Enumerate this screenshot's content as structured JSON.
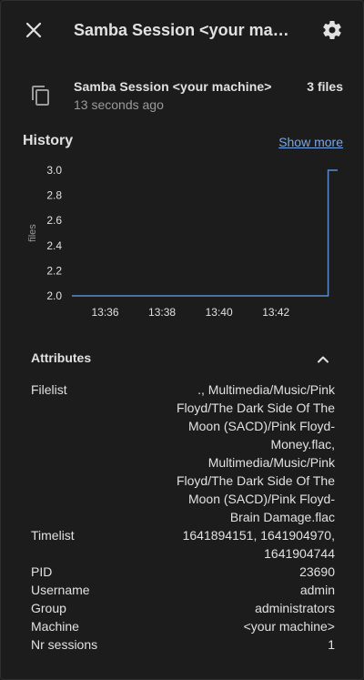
{
  "header": {
    "title": "Samba Session <your machine>",
    "close_icon": "close-icon",
    "settings_icon": "gear-icon"
  },
  "entity": {
    "name": "Samba Session <your machine>",
    "last_changed": "13 seconds ago",
    "state": "3 files",
    "icon": "file-document-icon"
  },
  "history": {
    "title": "History",
    "show_more": "Show more"
  },
  "chart_data": {
    "type": "line",
    "ylabel": "files",
    "y_ticks": [
      "3.0",
      "2.8",
      "2.6",
      "2.4",
      "2.2",
      "2.0"
    ],
    "x_ticks": [
      "13:36",
      "13:38",
      "13:40",
      "13:42"
    ],
    "ylim": [
      2.0,
      3.0
    ],
    "series": [
      {
        "x": [
          "13:34:50",
          "13:43:50",
          "13:43:50",
          "13:44:10"
        ],
        "values": [
          2.0,
          2.0,
          3.0,
          3.0
        ],
        "color": "#5b8bd0"
      }
    ],
    "grid": false
  },
  "attributes": {
    "title": "Attributes",
    "chevron_icon": "chevron-up-icon",
    "rows": [
      {
        "key": "Filelist",
        "value": "., Multimedia/Music/Pink Floyd/The Dark Side Of The Moon (SACD)/Pink Floyd-Money.flac, Multimedia/Music/Pink Floyd/The Dark Side Of The Moon (SACD)/Pink Floyd-Brain Damage.flac"
      },
      {
        "key": "Timelist",
        "value": "1641894151, 1641904970, 1641904744"
      },
      {
        "key": "PID",
        "value": "23690"
      },
      {
        "key": "Username",
        "value": "admin"
      },
      {
        "key": "Group",
        "value": "administrators"
      },
      {
        "key": "Machine",
        "value": "<your machine>"
      },
      {
        "key": "Nr sessions",
        "value": "1"
      }
    ]
  }
}
